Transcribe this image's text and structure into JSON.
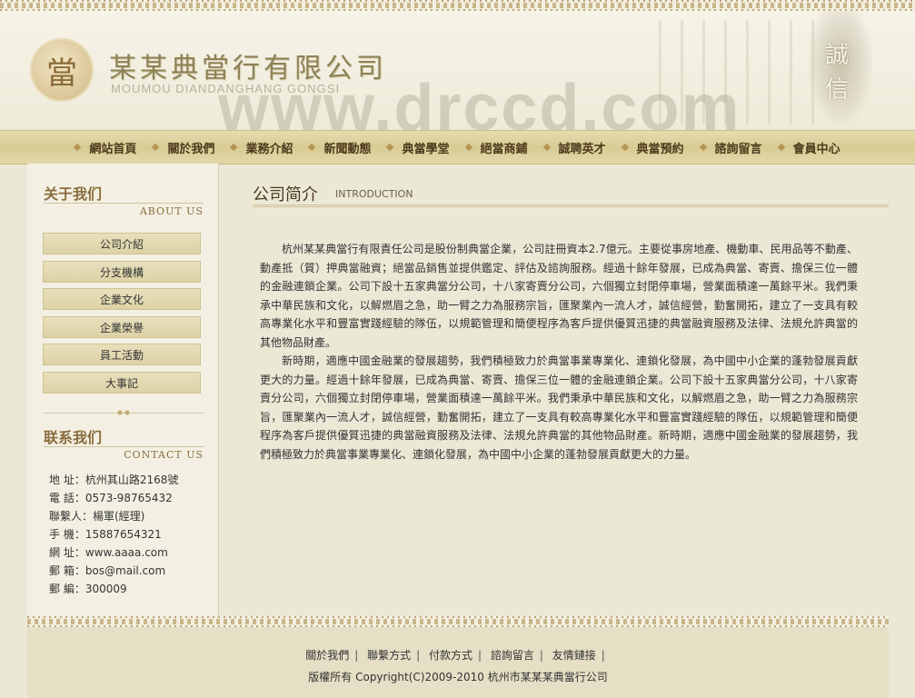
{
  "header": {
    "logo_char": "當",
    "company_cn": "某某典當行有限公司",
    "company_en": "MOUMOU DIANDANGHANG GONGSI",
    "watermark": "www.drccd.com",
    "motto_chars": [
      "誠",
      "信"
    ]
  },
  "nav": {
    "items": [
      {
        "label": "網站首頁"
      },
      {
        "label": "關於我們"
      },
      {
        "label": "業務介紹"
      },
      {
        "label": "新聞動態"
      },
      {
        "label": "典當學堂"
      },
      {
        "label": "絕當商鋪"
      },
      {
        "label": "誠聘英才"
      },
      {
        "label": "典當預約"
      },
      {
        "label": "諮詢留言"
      },
      {
        "label": "會員中心"
      }
    ]
  },
  "sidebar": {
    "about_title": "关于我们",
    "about_sub": "ABOUT US",
    "menu": [
      {
        "label": "公司介紹"
      },
      {
        "label": "分支機構"
      },
      {
        "label": "企業文化"
      },
      {
        "label": "企業榮譽"
      },
      {
        "label": "員工活動"
      },
      {
        "label": "大事記"
      }
    ],
    "contact_title": "联系我们",
    "contact_sub": "CONTACT US",
    "contact": [
      "地 址：杭州其山路2168號",
      "電 話：0573-98765432",
      "聯繫人：楊軍(經理)",
      "手 機：15887654321",
      "網 址：www.aaaa.com",
      "郵 箱：bos@mail.com",
      "郵 編：300009"
    ]
  },
  "main": {
    "title": "公司简介",
    "title_en": "INTRODUCTION",
    "paragraphs": [
      "杭州某某典當行有限責任公司是股份制典當企業，公司註冊資本2.7億元。主要從事房地產、機動車、民用品等不動產、動產抵（質）押典當融資；絕當品銷售並提供鑑定、評估及諮詢服務。經過十餘年發展，已成為典當、寄賣、擔保三位一體的金融連鎖企業。公司下設十五家典當分公司，十八家寄賣分公司，六個獨立封閉停車場，營業面積達一萬餘平米。我們秉承中華民族和文化，以解燃眉之急，助一臂之力為服務宗旨，匯聚業內一流人才，誠信經營，勤奮開拓，建立了一支具有較高專業化水平和豐富實踐經驗的隊伍，以規範管理和簡便程序為客戶提供優質迅捷的典當融資服務及法律、法規允許典當的其他物品財產。",
      "新時期，適應中國金融業的發展趨勢，我們積極致力於典當事業專業化、連鎖化發展，為中國中小企業的蓬勃發展貢獻更大的力量。經過十餘年發展，已成為典當、寄賣、擔保三位一體的金融連鎖企業。公司下設十五家典當分公司，十八家寄賣分公司，六個獨立封閉停車場，營業面積達一萬餘平米。我們秉承中華民族和文化，以解燃眉之急，助一臂之力為服務宗旨，匯聚業內一流人才，誠信經營，勤奮開拓，建立了一支具有較高專業化水平和豐富實踐經驗的隊伍，以規範管理和簡便程序為客戶提供優質迅捷的典當融資服務及法律、法規允許典當的其他物品財產。新時期，適應中國金融業的發展趨勢，我們積極致力於典當事業專業化、連鎖化發展，為中國中小企業的蓬勃發展貢獻更大的力量。"
    ]
  },
  "footer": {
    "links": [
      {
        "label": "關於我們"
      },
      {
        "label": "聯繫方式"
      },
      {
        "label": "付款方式"
      },
      {
        "label": "諮詢留言"
      },
      {
        "label": "友情鏈接"
      }
    ],
    "copyright": "版權所有 Copyright(C)2009-2010 杭州市某某某典當行公司"
  }
}
